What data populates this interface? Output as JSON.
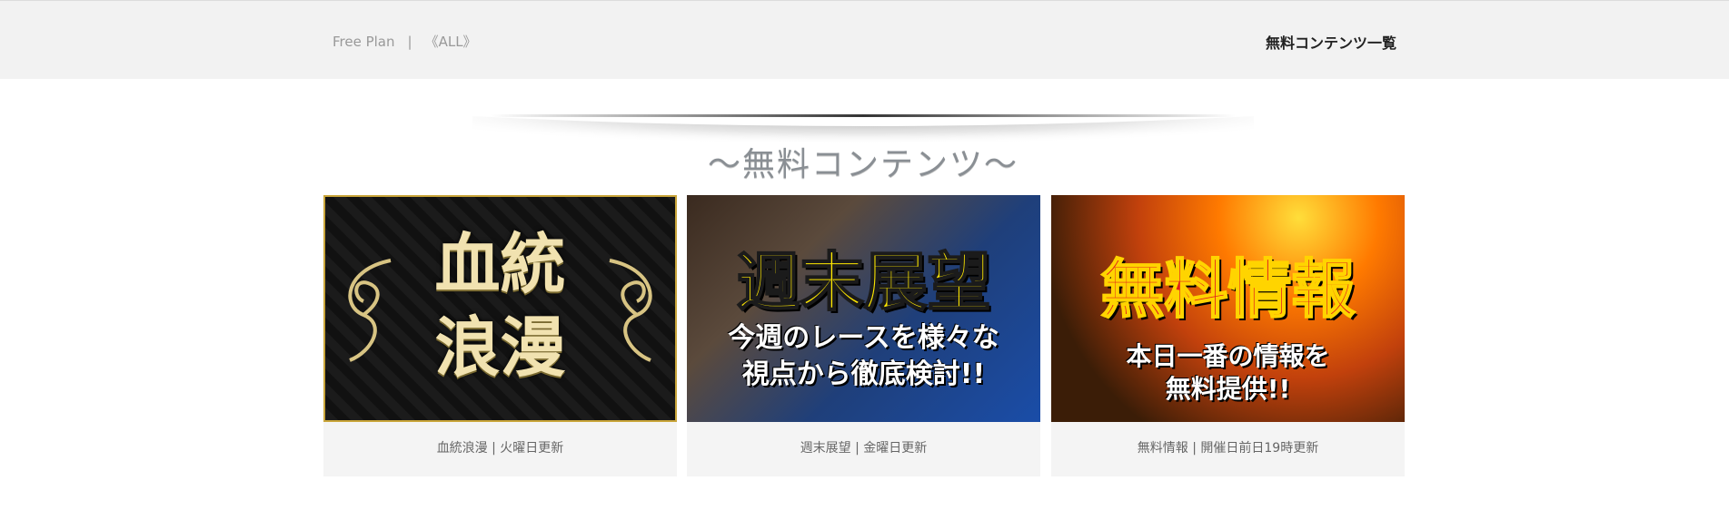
{
  "header": {
    "breadcrumb": [
      "Free Plan",
      "|",
      "《ALL》"
    ],
    "right_link": "無料コンテンツ一覧"
  },
  "banner": {
    "title": "〜無料コンテンツ〜"
  },
  "cards": [
    {
      "image_title_lines": [
        "血統",
        "浪漫"
      ],
      "caption": "血統浪漫 | 火曜日更新"
    },
    {
      "image_title": "週末展望",
      "image_subtitle_lines": [
        "今週のレースを様々な",
        "視点から徹底検討!!"
      ],
      "caption": "週末展望 | 金曜日更新"
    },
    {
      "image_title": "無料情報",
      "image_subtitle_lines": [
        "本日一番の情報を",
        "無料提供!!"
      ],
      "caption": "無料情報 | 開催日前日19時更新"
    }
  ],
  "colors": {
    "header_bg": "#f2f2f2",
    "card_bg": "#f4f4f4",
    "gold": "#c9a53a"
  }
}
